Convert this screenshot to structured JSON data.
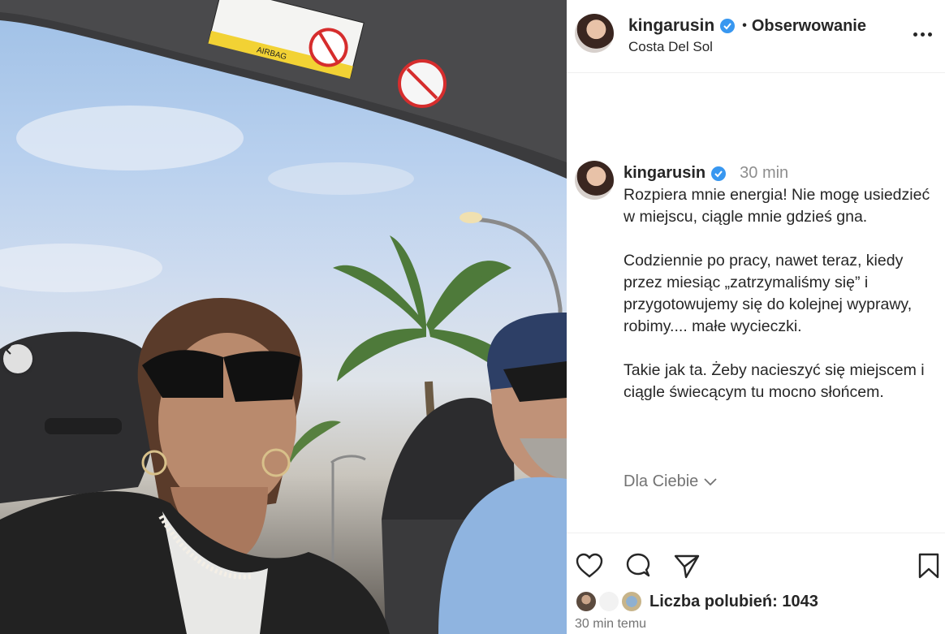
{
  "post": {
    "username": "kingarusin",
    "follow_label": "Obserwowanie",
    "dot": "•",
    "location": "Costa Del Sol",
    "caption_time": "30 min",
    "caption_paragraphs": [
      "Rozpiera mnie energia! Nie mogę usiedzieć w miejscu, ciągle mnie gdzieś gna.",
      "Codziennie po pracy, nawet teraz, kiedy przez miesiąc „zatrzymaliśmy się” i przygotowujemy się do kolejnej wyprawy, robimy.... małe wycieczki.",
      "Takie jak ta. Żeby nacieszyć się miejscem i ciągle świecącym tu mocno słońcem."
    ],
    "for_you_label": "Dla Ciebie",
    "likes_label": "Liczba polubień: 1043",
    "posted_ago": "30 min temu"
  },
  "media": {
    "airbag_text": "AIRBAG"
  },
  "icons": {
    "verified": "verified-badge-icon",
    "like": "heart-icon",
    "comment": "comment-icon",
    "share": "share-icon",
    "save": "bookmark-icon",
    "more": "more-options-icon",
    "prev": "chevron-left-icon",
    "for_you": "chevron-down-icon"
  },
  "colors": {
    "verified_blue": "#3897f0",
    "text": "#262626",
    "muted": "#737373"
  }
}
